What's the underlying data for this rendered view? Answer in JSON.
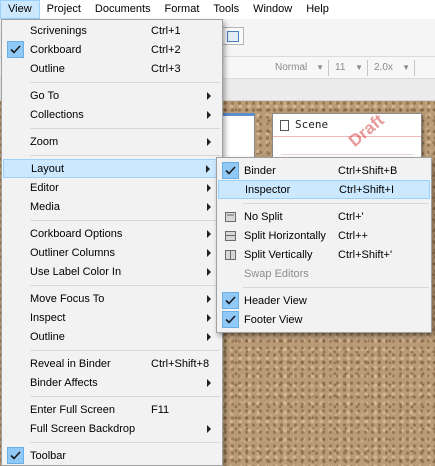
{
  "menubar": {
    "items": [
      "View",
      "Project",
      "Documents",
      "Format",
      "Tools",
      "Window",
      "Help"
    ]
  },
  "format_bar": {
    "style": "Normal",
    "size": "11",
    "spacing": "2.0x"
  },
  "card": {
    "title": "Scene",
    "stamp": "Draft"
  },
  "view_menu": {
    "items": [
      {
        "label": "Scrivenings",
        "shortcut": "Ctrl+1"
      },
      {
        "label": "Corkboard",
        "shortcut": "Ctrl+2",
        "checked": true
      },
      {
        "label": "Outline",
        "shortcut": "Ctrl+3"
      },
      {
        "label": "Go To",
        "submenu": true
      },
      {
        "label": "Collections",
        "submenu": true
      },
      {
        "label": "Zoom",
        "submenu": true
      },
      {
        "label": "Layout",
        "submenu": true,
        "highlighted": true
      },
      {
        "label": "Editor",
        "submenu": true
      },
      {
        "label": "Media",
        "submenu": true
      },
      {
        "label": "Corkboard Options",
        "submenu": true
      },
      {
        "label": "Outliner Columns",
        "submenu": true
      },
      {
        "label": "Use Label Color In",
        "submenu": true
      },
      {
        "label": "Move Focus To",
        "submenu": true
      },
      {
        "label": "Inspect",
        "submenu": true
      },
      {
        "label": "Outline",
        "submenu": true
      },
      {
        "label": "Reveal in Binder",
        "shortcut": "Ctrl+Shift+8"
      },
      {
        "label": "Binder Affects",
        "submenu": true
      },
      {
        "label": "Enter Full Screen",
        "shortcut": "F11"
      },
      {
        "label": "Full Screen Backdrop",
        "submenu": true
      },
      {
        "label": "Toolbar",
        "checked": true
      }
    ]
  },
  "layout_submenu": {
    "items": [
      {
        "label": "Binder",
        "shortcut": "Ctrl+Shift+B",
        "checked": true
      },
      {
        "label": "Inspector",
        "shortcut": "Ctrl+Shift+I",
        "highlighted": true
      },
      {
        "label": "No Split",
        "shortcut": "Ctrl+'",
        "icon": "no-split-icon"
      },
      {
        "label": "Split Horizontally",
        "shortcut": "Ctrl++",
        "icon": "split-horizontal-icon"
      },
      {
        "label": "Split Vertically",
        "shortcut": "Ctrl+Shift+'",
        "icon": "split-vertical-icon"
      },
      {
        "label": "Swap Editors",
        "disabled": true
      },
      {
        "label": "Header View",
        "checked": true
      },
      {
        "label": "Footer View",
        "checked": true
      }
    ]
  },
  "colors": {
    "highlight": "#cce8ff",
    "highlight_border": "#99d1ff",
    "check_bg": "#90c8f6",
    "menu_bg": "#f2f2f2",
    "cork": "#b99b78",
    "stamp": "#d64646"
  }
}
